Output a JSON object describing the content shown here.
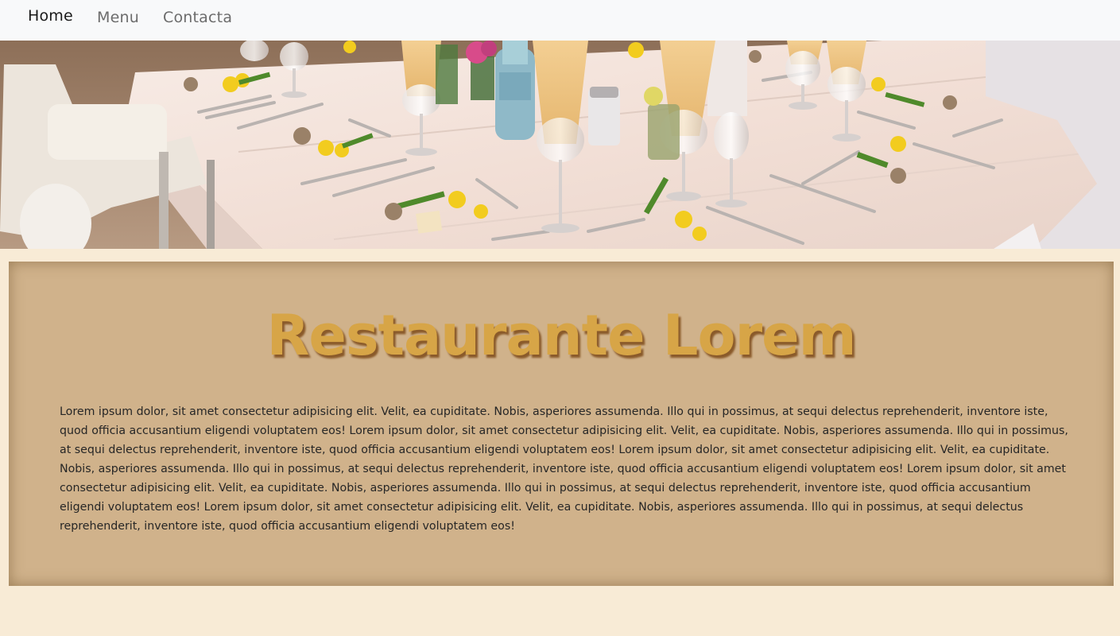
{
  "nav": {
    "items": [
      {
        "label": "Home",
        "active": true
      },
      {
        "label": "Menu",
        "active": false
      },
      {
        "label": "Contacta",
        "active": false
      }
    ]
  },
  "hero": {
    "image": "restaurant-table-setting-photo"
  },
  "card": {
    "title": "Restaurante Lorem",
    "body": "Lorem ipsum dolor, sit amet consectetur adipisicing elit. Velit, ea cupiditate. Nobis, asperiores assumenda. Illo qui in possimus, at sequi delectus reprehenderit, inventore iste, quod officia accusantium eligendi voluptatem eos! Lorem ipsum dolor, sit amet consectetur adipisicing elit. Velit, ea cupiditate. Nobis, asperiores assumenda. Illo qui in possimus, at sequi delectus reprehenderit, inventore iste, quod officia accusantium eligendi voluptatem eos! Lorem ipsum dolor, sit amet consectetur adipisicing elit. Velit, ea cupiditate. Nobis, asperiores assumenda. Illo qui in possimus, at sequi delectus reprehenderit, inventore iste, quod officia accusantium eligendi voluptatem eos! Lorem ipsum dolor, sit amet consectetur adipisicing elit. Velit, ea cupiditate. Nobis, asperiores assumenda. Illo qui in possimus, at sequi delectus reprehenderit, inventore iste, quod officia accusantium eligendi voluptatem eos! Lorem ipsum dolor, sit amet consectetur adipisicing elit. Velit, ea cupiditate. Nobis, asperiores assumenda. Illo qui in possimus, at sequi delectus reprehenderit, inventore iste, quod officia accusantium eligendi voluptatem eos!"
  },
  "colors": {
    "page_background": "#f8ebd6",
    "navbar_background": "#f8f9fa",
    "card_background": "#d0b28b",
    "title_color": "#d7a547",
    "title_shadow": "#8a5a2a"
  }
}
